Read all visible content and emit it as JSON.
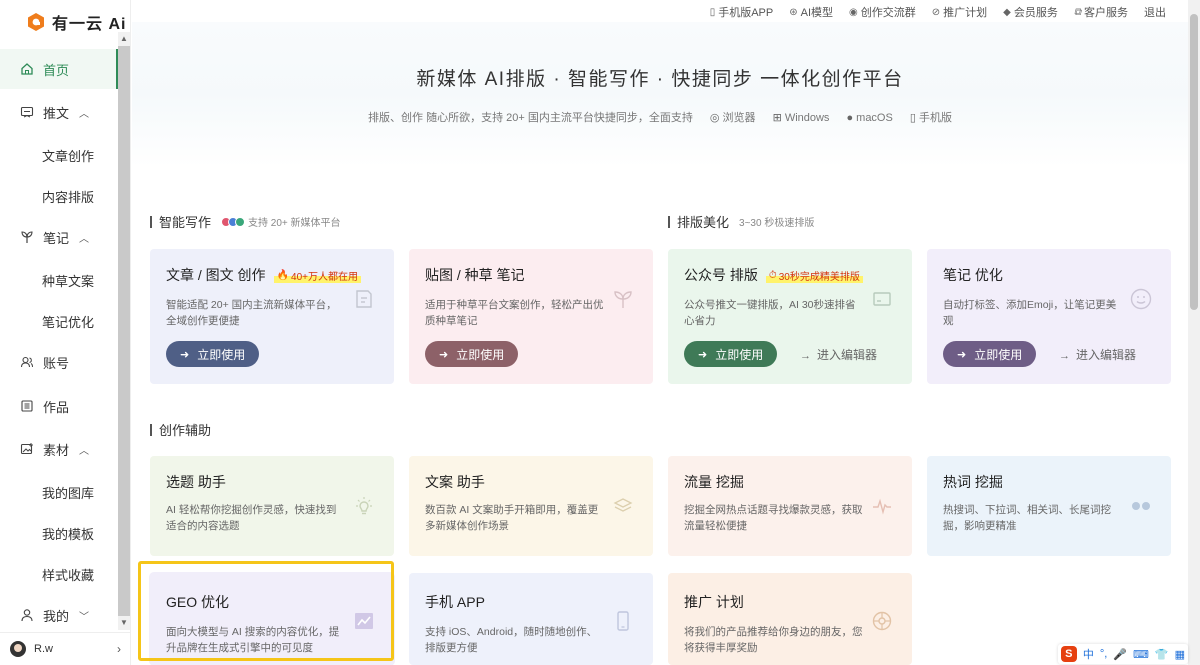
{
  "brand": {
    "name": "有一云 Ai",
    "accent": "#2e8b57",
    "logo_color": "#ef7d1c"
  },
  "top_links": [
    {
      "icon": "phone-icon",
      "label": "手机版APP"
    },
    {
      "icon": "ai-model-icon",
      "label": "AI模型"
    },
    {
      "icon": "chat-icon",
      "label": "创作交流群"
    },
    {
      "icon": "share-icon",
      "label": "推广计划"
    },
    {
      "icon": "diamond-icon",
      "label": "会员服务"
    },
    {
      "icon": "service-icon",
      "label": "客户服务"
    },
    {
      "icon": "",
      "label": "退出"
    }
  ],
  "sidebar": {
    "home": "首页",
    "tuiwen": "推文",
    "tuiwen_sub": [
      "文章创作",
      "内容排版"
    ],
    "notes": "笔记",
    "notes_sub": [
      "种草文案",
      "笔记优化"
    ],
    "account": "账号",
    "works": "作品",
    "material": "素材",
    "material_sub": [
      "我的图库",
      "我的模板",
      "样式收藏"
    ],
    "mine": "我的",
    "user": "R.w"
  },
  "hero": {
    "title": "新媒体 AI排版 · 智能写作 · 快捷同步 一体化创作平台",
    "subtitle": "排版、创作 随心所欲，支持 20+ 国内主流平台快捷同步，全面支持",
    "platforms": [
      "浏览器",
      "Windows",
      "macOS",
      "手机版"
    ]
  },
  "sections": {
    "writing": {
      "title": "智能写作",
      "note": "支持 20+ 新媒体平台"
    },
    "layout": {
      "title": "排版美化",
      "note": "3~30 秒极速排版"
    },
    "assist": {
      "title": "创作辅助"
    }
  },
  "cards_row1": [
    {
      "title": "文章 / 图文 创作",
      "badge": "40+万人都在用",
      "desc": "智能适配 20+ 国内主流新媒体平台，全域创作更便捷",
      "button": "立即使用",
      "link": "",
      "bg": "#eef0fa",
      "btn": "#4f5f86"
    },
    {
      "title": "贴图 / 种草 笔记",
      "badge": "",
      "desc": "适用于种草平台文案创作，轻松产出优质种草笔记",
      "button": "立即使用",
      "link": "",
      "bg": "#fcedf0",
      "btn": "#8d6168"
    },
    {
      "title": "公众号 排版",
      "badge": "30秒完成精美排版",
      "desc": "公众号推文一键排版，AI 30秒速排省心省力",
      "button": "立即使用",
      "link": "进入编辑器",
      "bg": "#eaf6ec",
      "btn": "#3f7a57"
    },
    {
      "title": "笔记 优化",
      "badge": "",
      "desc": "自动打标签、添加Emoji，让笔记更美观",
      "button": "立即使用",
      "link": "进入编辑器",
      "bg": "#f2eefa",
      "btn": "#6e5d86"
    }
  ],
  "cards_row2": [
    {
      "title": "选题 助手",
      "desc": "AI 轻松帮你挖掘创作灵感，快速找到适合的内容选题",
      "bg": "#f1f6ea"
    },
    {
      "title": "文案 助手",
      "desc": "数百款 AI 文案助手开箱即用，覆盖更多新媒体创作场景",
      "bg": "#fcf6e8"
    },
    {
      "title": "流量 挖掘",
      "desc": "挖掘全网热点话题寻找爆款灵感，获取流量轻松便捷",
      "bg": "#fcf1ec"
    },
    {
      "title": "热词 挖掘",
      "desc": "热搜词、下拉词、相关词、长尾词挖掘，影响更精准",
      "bg": "#ebf3fa"
    }
  ],
  "cards_row3": [
    {
      "title": "GEO 优化",
      "desc": "面向大模型与 AI 搜索的内容优化，提升品牌在生成式引擎中的可见度",
      "bg": "#f1eefa"
    },
    {
      "title": "手机 APP",
      "desc": "支持 iOS、Android，随时随地创作、排版更方便",
      "bg": "#eef1fb"
    },
    {
      "title": "推广 计划",
      "desc": "将我们的产品推荐给你身边的朋友，您将获得丰厚奖励",
      "bg": "#fcefe5"
    }
  ],
  "ime": {
    "label": "中"
  },
  "highlight_color": "#f5c518"
}
